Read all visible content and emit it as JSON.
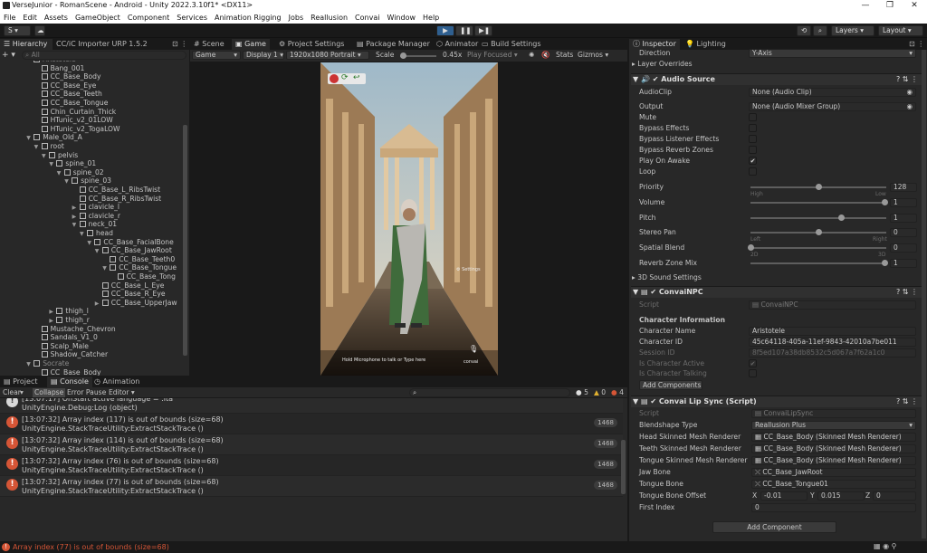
{
  "window": {
    "title": "VerseJunior - RomanScene - Android - Unity 2022.3.10f1* <DX11>"
  },
  "menu": [
    "File",
    "Edit",
    "Assets",
    "GameObject",
    "Component",
    "Services",
    "Animation Rigging",
    "Jobs",
    "Reallusion",
    "Convai",
    "Window",
    "Help"
  ],
  "toolbar": {
    "account": "S",
    "layers": "Layers",
    "layout": "Layout"
  },
  "hierarchy": {
    "tab1": "Hierarchy",
    "tab2": "CC/iC Importer URP 1.5.2",
    "search_placeholder": "All",
    "items": [
      {
        "name": "Aristotele",
        "d": 3,
        "arrow": ""
      },
      {
        "name": "Bang_001",
        "d": 4,
        "arrow": ""
      },
      {
        "name": "CC_Base_Body",
        "d": 4,
        "arrow": ""
      },
      {
        "name": "CC_Base_Eye",
        "d": 4,
        "arrow": ""
      },
      {
        "name": "CC_Base_Teeth",
        "d": 4,
        "arrow": ""
      },
      {
        "name": "CC_Base_Tongue",
        "d": 4,
        "arrow": ""
      },
      {
        "name": "Chin_Curtain_Thick",
        "d": 4,
        "arrow": ""
      },
      {
        "name": "HTunic_v2_01LOW",
        "d": 4,
        "arrow": ""
      },
      {
        "name": "HTunic_v2_TogaLOW",
        "d": 4,
        "arrow": ""
      },
      {
        "name": "Male_Old_A",
        "d": 3,
        "arrow": "▼"
      },
      {
        "name": "root",
        "d": 4,
        "arrow": "▼"
      },
      {
        "name": "pelvis",
        "d": 5,
        "arrow": "▼"
      },
      {
        "name": "spine_01",
        "d": 6,
        "arrow": "▼"
      },
      {
        "name": "spine_02",
        "d": 7,
        "arrow": "▼"
      },
      {
        "name": "spine_03",
        "d": 8,
        "arrow": "▼"
      },
      {
        "name": "CC_Base_L_RibsTwist",
        "d": 9,
        "arrow": ""
      },
      {
        "name": "CC_Base_R_RibsTwist",
        "d": 9,
        "arrow": ""
      },
      {
        "name": "clavicle_l",
        "d": 9,
        "arrow": "▶"
      },
      {
        "name": "clavicle_r",
        "d": 9,
        "arrow": "▶"
      },
      {
        "name": "neck_01",
        "d": 9,
        "arrow": "▼"
      },
      {
        "name": "head",
        "d": 10,
        "arrow": "▼"
      },
      {
        "name": "CC_Base_FacialBone",
        "d": 11,
        "arrow": "▼"
      },
      {
        "name": "CC_Base_JawRoot",
        "d": 12,
        "arrow": "▼"
      },
      {
        "name": "CC_Base_Teeth0",
        "d": 13,
        "arrow": ""
      },
      {
        "name": "CC_Base_Tongue",
        "d": 13,
        "arrow": "▼"
      },
      {
        "name": "CC_Base_Tong",
        "d": 14,
        "arrow": ""
      },
      {
        "name": "CC_Base_L_Eye",
        "d": 12,
        "arrow": ""
      },
      {
        "name": "CC_Base_R_Eye",
        "d": 12,
        "arrow": ""
      },
      {
        "name": "CC_Base_UpperJaw",
        "d": 12,
        "arrow": "▶"
      },
      {
        "name": "thigh_l",
        "d": 6,
        "arrow": "▶"
      },
      {
        "name": "thigh_r",
        "d": 6,
        "arrow": "▶"
      },
      {
        "name": "Mustache_Chevron",
        "d": 4,
        "arrow": ""
      },
      {
        "name": "Sandals_V1_0",
        "d": 4,
        "arrow": ""
      },
      {
        "name": "Scalp_Male",
        "d": 4,
        "arrow": ""
      },
      {
        "name": "Shadow_Catcher",
        "d": 4,
        "arrow": ""
      },
      {
        "name": "Socrate",
        "d": 3,
        "arrow": "▼"
      },
      {
        "name": "CC_Base_Body",
        "d": 4,
        "arrow": ""
      }
    ]
  },
  "scene_tabs": [
    "Scene",
    "Game",
    "Project Settings",
    "Package Manager",
    "Animator",
    "Build Settings"
  ],
  "game_toolbar": {
    "mode": "Game",
    "display": "Display 1",
    "resolution": "1920x1080 Portrait",
    "scale_label": "Scale",
    "scale_value": "0.45x",
    "play_focused": "Play Focused",
    "stats": "Stats",
    "gizmos": "Gizmos"
  },
  "game_view": {
    "settings_label": "Settings",
    "hint": "Hold Microphone to talk or Type here",
    "mic_label": "convai"
  },
  "bottom_tabs": [
    "Project",
    "Console",
    "Animation"
  ],
  "console": {
    "clear": "Clear",
    "collapse": "Collapse",
    "error_pause": "Error Pause",
    "editor": "Editor",
    "count_warn": "5",
    "count_info": "0",
    "count_err": "4",
    "logs": [
      {
        "line1": "[13:07:17] OnStart active language = :ita",
        "line2": "UnityEngine.Debug:Log (object)",
        "type": "info",
        "count": ""
      },
      {
        "line1": "[13:07:32] Array index (117) is out of bounds (size=68)",
        "line2": "UnityEngine.StackTraceUtility:ExtractStackTrace ()",
        "type": "error",
        "count": "1468"
      },
      {
        "line1": "[13:07:32] Array index (114) is out of bounds (size=68)",
        "line2": "UnityEngine.StackTraceUtility:ExtractStackTrace ()",
        "type": "error",
        "count": "1468"
      },
      {
        "line1": "[13:07:32] Array index (76) is out of bounds (size=68)",
        "line2": "UnityEngine.StackTraceUtility:ExtractStackTrace ()",
        "type": "error",
        "count": "1468"
      },
      {
        "line1": "[13:07:32] Array index (77) is out of bounds (size=68)",
        "line2": "UnityEngine.StackTraceUtility:ExtractStackTrace ()",
        "type": "error",
        "count": "1468"
      }
    ]
  },
  "status_bar": {
    "message": "Array index (77) is out of bounds (size=68)"
  },
  "inspector": {
    "tab1": "Inspector",
    "tab2": "Lighting",
    "direction_label": "Direction",
    "direction_value": "Y-Axis",
    "layer_overrides": "Layer Overrides",
    "audio_source": {
      "title": "Audio Source",
      "audioclip_label": "AudioClip",
      "audioclip_value": "None (Audio Clip)",
      "output_label": "Output",
      "output_value": "None (Audio Mixer Group)",
      "mute": "Mute",
      "bypass_effects": "Bypass Effects",
      "bypass_listener": "Bypass Listener Effects",
      "bypass_reverb": "Bypass Reverb Zones",
      "play_on_awake": "Play On Awake",
      "loop": "Loop",
      "priority_label": "Priority",
      "priority_value": "128",
      "high": "High",
      "low": "Low",
      "volume_label": "Volume",
      "volume_value": "1",
      "pitch_label": "Pitch",
      "pitch_value": "1",
      "stereo_label": "Stereo Pan",
      "stereo_value": "0",
      "left": "Left",
      "right": "Right",
      "spatial_label": "Spatial Blend",
      "spatial_value": "0",
      "d2": "2D",
      "d3": "3D",
      "reverb_label": "Reverb Zone Mix",
      "reverb_value": "1",
      "settings3d": "3D Sound Settings"
    },
    "convai_npc": {
      "title": "ConvaiNPC",
      "script_label": "Script",
      "script_value": "ConvaiNPC",
      "char_info": "Character Information",
      "name_label": "Character Name",
      "name_value": "Aristotele",
      "id_label": "Character ID",
      "id_value": "45c64118-405a-11ef-9843-42010a7be011",
      "session_label": "Session ID",
      "session_value": "8f5ed107a38db8532c5d067a7f62a1c0",
      "active_label": "Is Character Active",
      "talking_label": "Is Character Talking",
      "add_components": "Add Components"
    },
    "lip_sync": {
      "title": "Convai Lip Sync (Script)",
      "script_label": "Script",
      "script_value": "ConvaiLipSync",
      "blend_label": "Blendshape Type",
      "blend_value": "Reallusion Plus",
      "head_label": "Head Skinned Mesh Renderer",
      "head_value": "CC_Base_Body (Skinned Mesh Renderer)",
      "teeth_label": "Teeth Skinned Mesh Renderer",
      "teeth_value": "CC_Base_Body (Skinned Mesh Renderer)",
      "tongue_label": "Tongue Skinned Mesh Renderer",
      "tongue_value": "CC_Base_Body (Skinned Mesh Renderer)",
      "jaw_label": "Jaw Bone",
      "jaw_value": "CC_Base_JawRoot",
      "tbone_label": "Tongue Bone",
      "tbone_value": "CC_Base_Tongue01",
      "offset_label": "Tongue Bone Offset",
      "ox": "X",
      "oxv": "-0.01",
      "oy": "Y",
      "oyv": "0.015",
      "oz": "Z",
      "ozv": "0",
      "first_label": "First Index",
      "first_value": "0"
    },
    "add_component": "Add Component"
  }
}
